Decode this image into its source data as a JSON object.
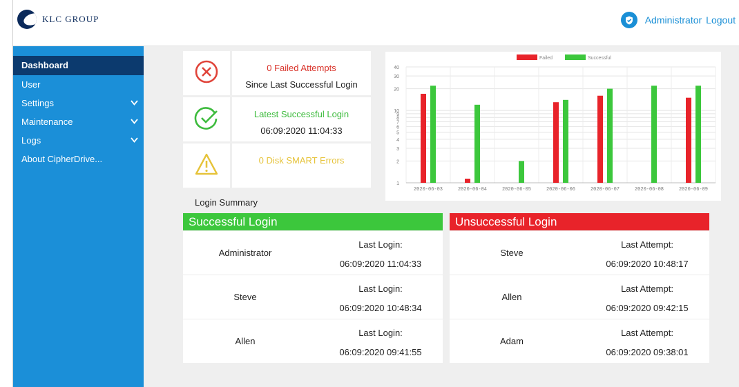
{
  "header": {
    "brand": "KLC GROUP",
    "admin_label": "Administrator",
    "logout_label": "Logout"
  },
  "sidebar": {
    "items": [
      {
        "label": "Dashboard",
        "active": true,
        "chevron": false
      },
      {
        "label": "User",
        "active": false,
        "chevron": false
      },
      {
        "label": "Settings",
        "active": false,
        "chevron": true
      },
      {
        "label": "Maintenance",
        "active": false,
        "chevron": true
      },
      {
        "label": "Logs",
        "active": false,
        "chevron": true
      },
      {
        "label": "About CipherDrive...",
        "active": false,
        "chevron": false
      }
    ]
  },
  "status": {
    "failed": {
      "line1": "0 Failed Attempts",
      "line2": "Since Last Successful Login",
      "color": "#d9342b",
      "icon": "x-circle-icon"
    },
    "success": {
      "line1": "Latest Successful Login",
      "line2": "06:09:2020 11:04:33",
      "color": "#3dbb3d",
      "icon": "check-circle-icon"
    },
    "disk": {
      "line1": "0 Disk SMART Errors",
      "color": "#e6c33a",
      "icon": "warning-triangle-icon"
    }
  },
  "chart_data": {
    "type": "bar",
    "categories": [
      "2020-06-03",
      "2020-06-04",
      "2020-06-05",
      "2020-06-06",
      "2020-06-07",
      "2020-06-08",
      "2020-06-09"
    ],
    "series": [
      {
        "name": "Failed",
        "color": "#e8232a",
        "values": [
          17,
          1,
          0,
          13,
          16,
          0,
          15
        ]
      },
      {
        "name": "Successful",
        "color": "#3cc73c",
        "values": [
          22,
          12,
          2,
          14,
          20,
          22,
          22
        ]
      }
    ],
    "yticks": [
      1,
      2,
      3,
      4,
      5,
      6,
      7,
      8,
      9,
      10,
      20,
      30,
      40
    ],
    "ylim": [
      1,
      40
    ],
    "yscale": "log",
    "legend": "top",
    "grid": true
  },
  "login_summary": {
    "title": "Login Summary",
    "successful": {
      "heading": "Successful Login",
      "color": "#3cc73c",
      "rows": [
        {
          "name": "Administrator",
          "label": "Last Login:",
          "time": "06:09:2020 11:04:33"
        },
        {
          "name": "Steve",
          "label": "Last Login:",
          "time": "06:09:2020 10:48:34"
        },
        {
          "name": "Allen",
          "label": "Last Login:",
          "time": "06:09:2020 09:41:55"
        }
      ]
    },
    "unsuccessful": {
      "heading": "Unsuccessful Login",
      "color": "#e8232a",
      "rows": [
        {
          "name": "Steve",
          "label": "Last Attempt:",
          "time": "06:09:2020 10:48:17"
        },
        {
          "name": "Allen",
          "label": "Last Attempt:",
          "time": "06:09:2020 09:42:15"
        },
        {
          "name": "Adam",
          "label": "Last Attempt:",
          "time": "06:09:2020 09:38:01"
        }
      ]
    }
  }
}
